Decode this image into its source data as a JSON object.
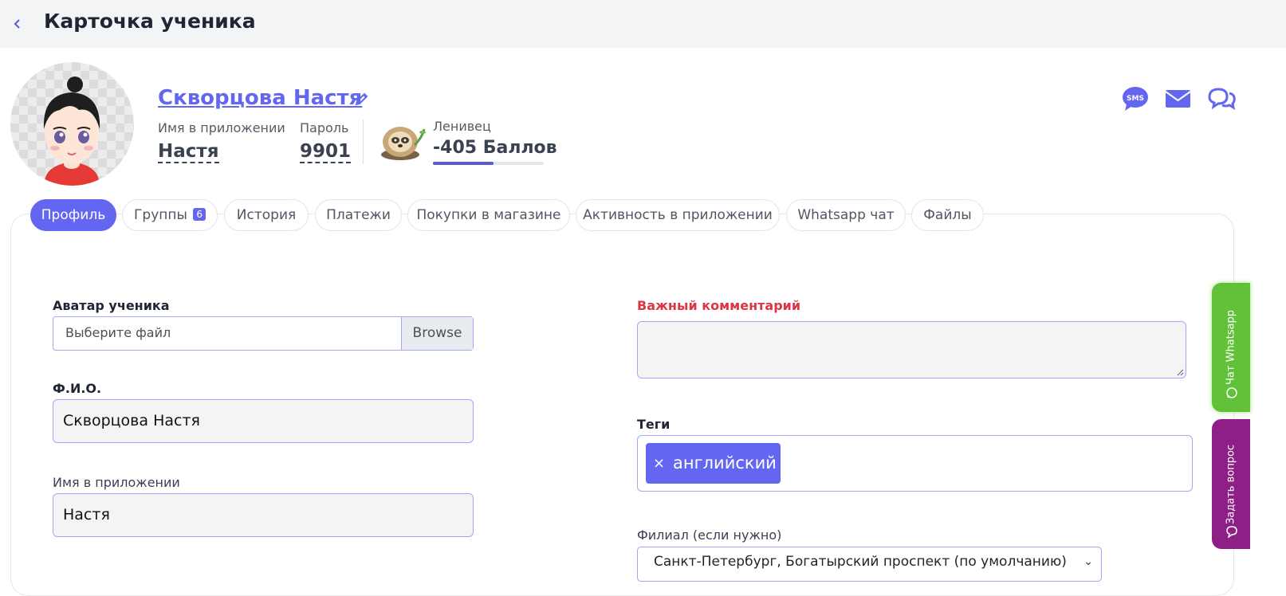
{
  "header": {
    "title": "Карточка ученика"
  },
  "student": {
    "name": "Скворцова Настя",
    "app_name_label": "Имя в приложении",
    "app_name": "Настя",
    "password_label": "Пароль",
    "password": "9901",
    "level": "Ленивец",
    "points": "-405 Баллов",
    "points_progress": 0.55
  },
  "contact_icons": [
    "sms-icon",
    "mail-icon",
    "chat-icon"
  ],
  "tabs": [
    {
      "label": "Профиль",
      "active": true
    },
    {
      "label": "Группы",
      "badge": "6"
    },
    {
      "label": "История"
    },
    {
      "label": "Платежи"
    },
    {
      "label": "Покупки в магазине"
    },
    {
      "label": "Активность в приложении"
    },
    {
      "label": "Whatsapp чат"
    },
    {
      "label": "Файлы"
    }
  ],
  "form": {
    "avatar_label": "Аватар ученика",
    "avatar_placeholder": "Выберите файл",
    "browse_label": "Browse",
    "fio_label": "Ф.И.О.",
    "fio_value": "Скворцова Настя",
    "app_name_label": "Имя в приложении",
    "app_name_value": "Настя",
    "comment_label": "Важный комментарий",
    "comment_value": "",
    "tags_label": "Теги",
    "tags": [
      {
        "remove": "×",
        "text": "английский"
      }
    ],
    "branch_label": "Филиал (если нужно)",
    "branch_value": "Санкт-Петербург, Богатырский проспект (по умолчанию)"
  },
  "side_buttons": {
    "whatsapp": "Чат Whatsapp",
    "question": "Задать вопрос"
  },
  "colors": {
    "accent": "#6366f1",
    "danger": "#dc3545",
    "whatsapp": "#61c23a",
    "question": "#8e1f86"
  }
}
